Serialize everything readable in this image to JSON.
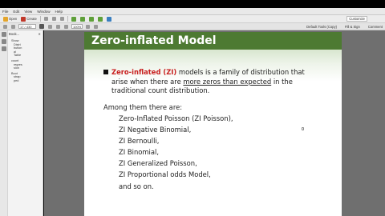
{
  "menubar": {
    "items": [
      "File",
      "Edit",
      "View",
      "Window",
      "Help"
    ]
  },
  "toolbar": {
    "open_label": "Open",
    "create_label": "Create",
    "customize_label": "Customize"
  },
  "navbar": {
    "page_value": "17 / 430",
    "zoom_value": "100%",
    "tools_label": "Default Tools (Copy)",
    "fill_sign_label": "Fill & Sign",
    "comment_label": "Comment"
  },
  "bookmarks": {
    "header": "Book...",
    "entries": [
      "Show",
      "Distri",
      "bution",
      "al",
      "Table",
      "count",
      "regres",
      "sion",
      "Boot",
      "strap",
      "ped"
    ]
  },
  "slide": {
    "title": "Zero-inflated Model",
    "bullet_term": "Zero-inflated (ZI)",
    "bullet_rest_1": " models is a family of distribution that",
    "bullet_line2_pre": "arise when there are ",
    "bullet_line2_emph": " more zeros than expected",
    "bullet_line2_post": " in the",
    "bullet_line3": "traditional count distribution.",
    "intro": "Among them there are:",
    "models": [
      "Zero-Inflated Poisson (ZI Poisson),",
      "ZI Negative Binomial,",
      "ZI Bernoulli,",
      "ZI Binomial,",
      "ZI Generalized Poisson,",
      "ZI Proportional odds Model,",
      "and so on."
    ]
  }
}
